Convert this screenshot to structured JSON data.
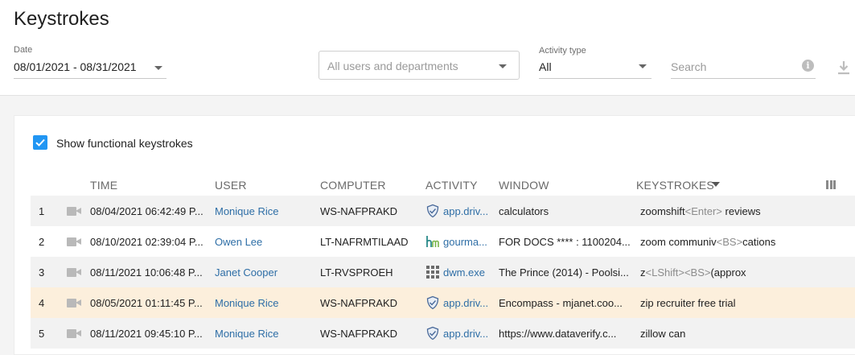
{
  "page": {
    "title": "Keystrokes"
  },
  "filters": {
    "date": {
      "label": "Date",
      "value": "08/01/2021 - 08/31/2021"
    },
    "users": {
      "placeholder": "All users and departments"
    },
    "activity_type": {
      "label": "Activity type",
      "value": "All"
    },
    "search": {
      "placeholder": "Search"
    }
  },
  "options": {
    "show_functional_label": "Show functional keystrokes",
    "show_functional_checked": true
  },
  "table": {
    "headers": {
      "time": "TIME",
      "user": "USER",
      "computer": "COMPUTER",
      "activity": "ACTIVITY",
      "window": "WINDOW",
      "keystrokes": "KEYSTROKES"
    },
    "sort_column": "keystrokes",
    "rows": [
      {
        "num": "1",
        "time": "08/04/2021 06:42:49 P...",
        "user": "Monique Rice",
        "computer": "WS-NAFPRAKD",
        "activity": "app.driv...",
        "activity_icon": "shield-icon",
        "window": "calculators",
        "ks_a": "zoomshift",
        "ks_b": "<Enter>",
        "ks_c": " reviews",
        "ks_d": "",
        "ks_e": ""
      },
      {
        "num": "2",
        "time": "08/10/2021 02:39:04 P...",
        "user": "Owen Lee",
        "computer": "LT-NAFRMTILAAD",
        "activity": "gourma...",
        "activity_icon": "hm-logo-icon",
        "window": "FOR DOCS **** : 1100204...",
        "ks_a": "zoom communiv",
        "ks_b": "<BS>",
        "ks_c": "cations",
        "ks_d": "",
        "ks_e": ""
      },
      {
        "num": "3",
        "time": "08/11/2021 10:06:48 P...",
        "user": "Janet Cooper",
        "computer": "LT-RVSPROEH",
        "activity": "dwm.exe",
        "activity_icon": "grid-icon",
        "window": "The Prince (2014) - Poolsi...",
        "ks_a": "z",
        "ks_b": "<LShift>",
        "ks_c": "",
        "ks_d": "<BS>",
        "ks_e": "(approx"
      },
      {
        "num": "4",
        "time": "08/05/2021 01:11:45 P...",
        "user": "Monique Rice",
        "computer": "WS-NAFPRAKD",
        "activity": "app.driv...",
        "activity_icon": "shield-icon",
        "window": "Encompass - mjanet.coo...",
        "ks_a": "zip recruiter free trial",
        "ks_b": "",
        "ks_c": "",
        "ks_d": "",
        "ks_e": ""
      },
      {
        "num": "5",
        "time": "08/11/2021 09:45:10 P...",
        "user": "Monique Rice",
        "computer": "WS-NAFPRAKD",
        "activity": "app.driv...",
        "activity_icon": "shield-icon",
        "window": "https://www.dataverify.c...",
        "ks_a": "zillow can",
        "ks_b": "",
        "ks_c": "",
        "ks_d": "",
        "ks_e": ""
      }
    ]
  },
  "colors": {
    "accent": "#2196f3",
    "link": "#2e6ea6",
    "highlight_row": "#fcefdc",
    "special_key": "#8c8c8c"
  }
}
